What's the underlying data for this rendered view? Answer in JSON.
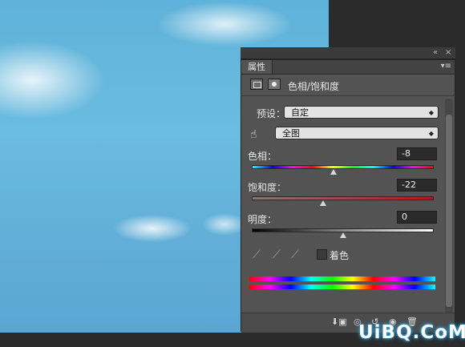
{
  "panel": {
    "tab_label": "属性",
    "title": "色相/饱和度",
    "preset_label": "预设：",
    "preset_value": "自定",
    "channel_value": "全图",
    "hue_label": "色相：",
    "hue_value": "-8",
    "saturation_label": "饱和度：",
    "saturation_value": "-22",
    "lightness_label": "明度：",
    "lightness_value": "0",
    "colorize_label": "着色"
  },
  "controls": {
    "collapse_icon": "«",
    "close_icon": "×"
  },
  "icons": {
    "adjustment_icon": "adjustment-icon",
    "mask_icon": "mask-icon",
    "hand_tool_icon": "hand-icon",
    "eyedropper_icon": "eyedropper-icon"
  },
  "sliders": {
    "hue_fraction": 0.45,
    "saturation_fraction": 0.39,
    "lightness_fraction": 0.5
  },
  "watermark": {
    "text": "UiBQ.CoM"
  },
  "colors": {
    "panel_bg": "#535353",
    "sky_blue": "#6bbce0"
  }
}
